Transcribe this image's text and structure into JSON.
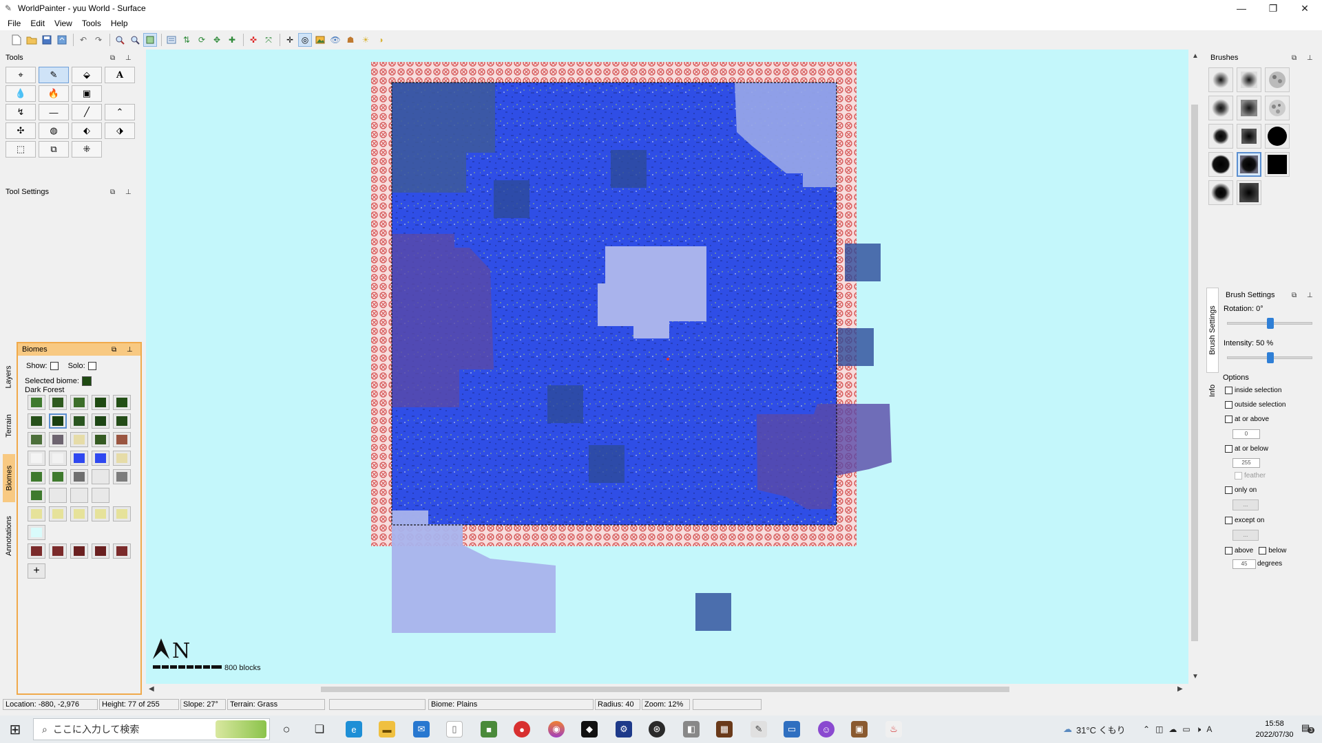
{
  "window": {
    "title": "WorldPainter - yuu World - Surface",
    "controls": [
      "—",
      "❐",
      "✕"
    ]
  },
  "menu": [
    "File",
    "Edit",
    "View",
    "Tools",
    "Help"
  ],
  "panels": {
    "tools_title": "Tools",
    "tool_settings_title": "Tool Settings",
    "biomes_title": "Biomes",
    "brushes_title": "Brushes",
    "brush_settings_title": "Brush Settings",
    "panel_buttons": [
      "⧉",
      "⊥"
    ]
  },
  "tools": [
    "⌖",
    "✎",
    "⬙",
    "A",
    "💧",
    "🔥",
    "▣",
    "↯",
    "—",
    "╱",
    "⌃",
    "✣",
    "◍",
    "⬖",
    "⬗",
    "⬚",
    "⧉",
    "⁜"
  ],
  "biomes": {
    "show_label": "Show:",
    "solo_label": "Solo:",
    "selected_label": "Selected biome:",
    "selected_name": "Dark Forest",
    "add_button": "+",
    "cells": [
      {
        "color": "#3f7a2e"
      },
      {
        "color": "#2f5a1f"
      },
      {
        "color": "#3c6e2a"
      },
      {
        "color": "#1f4a12"
      },
      {
        "color": "#234f16"
      },
      {
        "color": "#26501a"
      },
      {
        "color": "#1a3f10"
      },
      {
        "color": "#2a5520"
      },
      {
        "color": "#1d4514"
      },
      {
        "color": "#244c18"
      },
      {
        "color": "#4c6f3a"
      },
      {
        "color": "#6d6470"
      },
      {
        "color": "#e6dca8"
      },
      {
        "color": "#355a22"
      },
      {
        "color": "#9a5540"
      },
      {
        "color": "#f4f4f4"
      },
      {
        "color": "#f2f2f2"
      },
      {
        "color": "#2f48f0"
      },
      {
        "color": "#2f48f0"
      },
      {
        "color": "#e6dca8"
      },
      {
        "color": "#3f7a2e"
      },
      {
        "color": "#3f7a2e"
      },
      {
        "color": "#6f6f6f"
      },
      {
        "color": "#e8e8e8"
      },
      {
        "color": "#7c7c7c"
      },
      {
        "color": "#3f7a2e"
      },
      {
        "color": "#e8e8e8"
      },
      {
        "color": "#e8e8e8"
      },
      {
        "color": "#e8e8e8"
      },
      null,
      {
        "color": "#e6e29a"
      },
      {
        "color": "#e6e29a"
      },
      {
        "color": "#e6e29a"
      },
      {
        "color": "#e6e29a"
      },
      {
        "color": "#e6e29a"
      },
      {
        "color": "#d9fbfb"
      },
      null,
      null,
      null,
      null,
      {
        "color": "#7b2b2b"
      },
      {
        "color": "#7b2b2b"
      },
      {
        "color": "#6a2020"
      },
      {
        "color": "#6a2020"
      },
      {
        "color": "#7b2b2b"
      }
    ]
  },
  "side_tabs": [
    "Layers",
    "Terrain",
    "Biomes",
    "Annotations"
  ],
  "right_tabs": [
    "Brush Settings",
    "Info"
  ],
  "map": {
    "scale_label": "800 blocks",
    "compass_label": "N"
  },
  "brush_settings": {
    "rotation_label": "Rotation: 0°",
    "rotation_value": 0.5,
    "intensity_label": "Intensity: 50 %",
    "intensity_value": 0.5,
    "options_label": "Options",
    "inside_selection": "inside selection",
    "outside_selection": "outside selection",
    "at_or_above": "at or above",
    "at_or_above_value": "0",
    "at_or_below": "at or below",
    "at_or_below_value": "255",
    "feather": "feather",
    "only_on": "only on",
    "only_on_value": "...",
    "except_on": "except on",
    "except_on_value": "...",
    "above": "above",
    "below": "below",
    "degrees_value": "45",
    "degrees_label": "degrees"
  },
  "status": {
    "location": "Location: -880, -2,976",
    "height": "Height: 77 of 255",
    "slope": "Slope: 27°",
    "terrain": "Terrain: Grass",
    "empty1": "",
    "biome": "Biome: Plains",
    "radius": "Radius: 40",
    "zoom": "Zoom: 12%",
    "empty2": ""
  },
  "taskbar": {
    "start_icon": "⊞",
    "search_placeholder": "ここに入力して検索",
    "weather": "31°C くもり",
    "time": "15:58",
    "date": "2022/07/30",
    "ime": "A",
    "notification_count": "3"
  }
}
